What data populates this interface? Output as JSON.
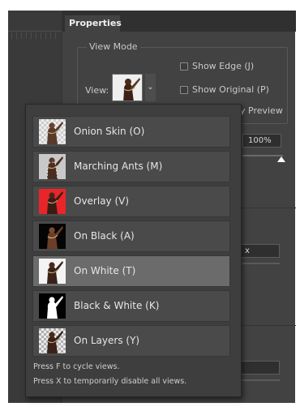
{
  "panel": {
    "tab_label": "Properties",
    "view_mode_legend": "View Mode",
    "view_label": "View:",
    "show_edge": "Show Edge (J)",
    "show_original": "Show Original (P)",
    "partial_preview": "y Preview",
    "transparency_value": "100%",
    "field_partial_char": "x"
  },
  "dropdown": {
    "items": [
      {
        "label": "Onion Skin (O)",
        "thumb": "onion-skin",
        "selected": false
      },
      {
        "label": "Marching Ants (M)",
        "thumb": "marching-ants",
        "selected": false
      },
      {
        "label": "Overlay (V)",
        "thumb": "overlay",
        "selected": false
      },
      {
        "label": "On Black (A)",
        "thumb": "on-black",
        "selected": false
      },
      {
        "label": "On White (T)",
        "thumb": "on-white",
        "selected": true
      },
      {
        "label": "Black & White (K)",
        "thumb": "black-white",
        "selected": false
      },
      {
        "label": "On Layers (Y)",
        "thumb": "on-layers",
        "selected": false
      }
    ],
    "hint_line_1": "Press F to cycle views.",
    "hint_line_2": "Press X to temporarily disable all views."
  },
  "colors": {
    "panel_bg": "#424242",
    "selected_item": "#6b6b6b",
    "overlay_red": "#e8262a"
  }
}
